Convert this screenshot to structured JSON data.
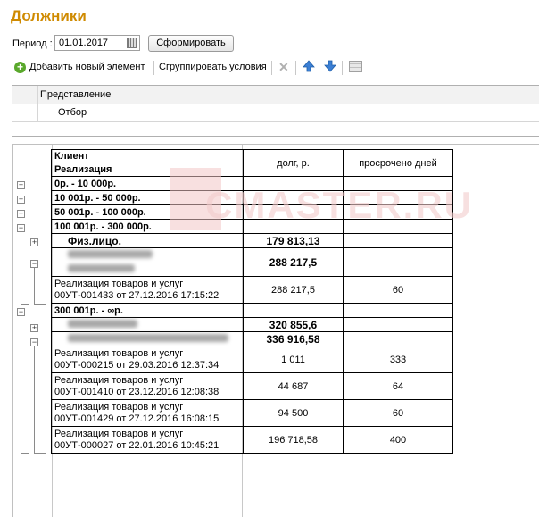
{
  "header": {
    "title": "Должники"
  },
  "period": {
    "label": "Период",
    "colon": ":",
    "value": "01.01.2017",
    "button": "Сформировать"
  },
  "toolbar": {
    "add_label": "Добавить новый элемент",
    "group_label": "Сгруппировать условия"
  },
  "settings": {
    "header": "Представление",
    "row": "Отбор"
  },
  "watermark": {
    "text": "CMASTER.RU"
  },
  "report": {
    "col_client": "Клиент",
    "col_realization": "Реализация",
    "col_debt": "долг, р.",
    "col_overdue": "просрочено дней",
    "rows": [
      {
        "text": "0р. - 10 000р.",
        "debt": "",
        "days": ""
      },
      {
        "text": "10 001р. - 50 000р.",
        "debt": "",
        "days": ""
      },
      {
        "text": "50 001р. - 100 000р.",
        "debt": "",
        "days": ""
      },
      {
        "text": "100 001р. - 300 000р.",
        "debt": "",
        "days": ""
      },
      {
        "text": "Физ.лицо.",
        "debt": "179 813,13",
        "days": ""
      },
      {
        "text": "",
        "debt": "288 217,5",
        "days": ""
      },
      {
        "text": "Реализация товаров и услуг\n00УТ-001433 от 27.12.2016 17:15:22",
        "debt": "288 217,5",
        "days": "60"
      },
      {
        "text": "300 001р. - ∞р.",
        "debt": "",
        "days": ""
      },
      {
        "text": "",
        "debt": "320 855,6",
        "days": ""
      },
      {
        "text": "",
        "debt": "336 916,58",
        "days": ""
      },
      {
        "text": "Реализация товаров и услуг\n00УТ-000215 от 29.03.2016 12:37:34",
        "debt": "1 011",
        "days": "333"
      },
      {
        "text": "Реализация товаров и услуг\n00УТ-001410 от 23.12.2016 12:08:38",
        "debt": "44 687",
        "days": "64"
      },
      {
        "text": "Реализация товаров и услуг\n00УТ-001429 от 27.12.2016 16:08:15",
        "debt": "94 500",
        "days": "60"
      },
      {
        "text": "Реализация товаров и услуг\n00УТ-000027 от 22.01.2016 10:45:21",
        "debt": "196 718,58",
        "days": "400"
      }
    ]
  }
}
